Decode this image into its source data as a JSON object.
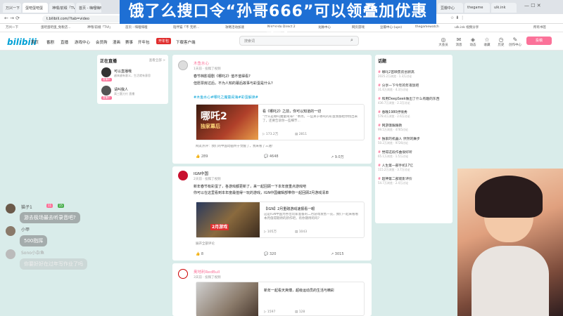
{
  "browser": {
    "tabs": [
      "万兴一下",
      "蛋吧蛋吧蛋",
      "神嘿/前缀「TVI」",
      "首页 - 嗨哩嗨哩",
      "陪伴猫「不 无所",
      "攻略活动",
      "加速",
      "Nintendo Direct",
      "龙脉中心",
      "网页游戏",
      "豆瓣中心",
      "thegame",
      "ulk.ink"
    ],
    "url": "t.bilibili.com/?tab=video",
    "bookmarks": [
      "万兴一下",
      "蛋吧蛋吧蛋_免税店...",
      "神嘿/前缀「TVI」",
      "首页 - 嗨哩嗨哩",
      "陪伴猫「不 无所...",
      "攻略活动加速",
      "Nintendo Direct 2",
      "龙脉中心",
      "网页游戏",
      "豆瓣中心-(ups)",
      "thegamewatch",
      "ulk.ink 视频分享",
      "所有书签"
    ]
  },
  "banner": "饿了么搜口令“孙哥666”可以领叠加优惠券!",
  "header": {
    "logo": "bilibili",
    "nav": [
      "首页",
      "番剧",
      "直播",
      "游戏中心",
      "会员购",
      "漫画",
      "赛事",
      "开年包",
      "下载客户端"
    ],
    "nav_tag": "开年包",
    "search_placeholder": "搜索词",
    "icons": [
      "大会员",
      "消息",
      "动态",
      "收藏",
      "历史",
      "创作中心"
    ],
    "upload": "投稿"
  },
  "live": {
    "title": "正在直播",
    "more": "查看全部 >",
    "items": [
      {
        "name": "可以直播哦",
        "desc": "越来越有意义，生活就有意思",
        "badge": "直播中"
      },
      {
        "name": "请叫我人",
        "desc": "高三题刀刃 直播",
        "badge": "直播中"
      }
    ]
  },
  "posts": [
    {
      "author": "木鱼水心",
      "meta": "1天前 · 投稿了视频",
      "text1": "春节档影视剧《哪吒2》值不值得看?",
      "text2": "但愿票房过后，不为人知的幕后故事与彩蛋是什么?",
      "tags": "#木鱼水心#哪吒之魔童闹海#彩蛋解读#",
      "thumb": "哪吒2",
      "thumb_sub": "独家幕后",
      "vtitle": "看《哪吒2》之前，你可以知道的一切",
      "vdesc": "“什么是哪吒魔童闹海？”本周，一些关于哪吒的彩蛋我都给你找出来了，还要告诉你一些细节...",
      "views": "173.2万",
      "danmu": "2811",
      "comment_preview": "网友热评：我们的中国动画终于觉醒了，我来看了三遍!",
      "likes": "289",
      "comments": "4648",
      "shares": "9.0万"
    },
    {
      "author": "IGN中国",
      "meta": "2天前 · 投稿了视频",
      "text1": "新年春节有彩蛋了，各游戏都更新了，来一起回顾一下本年度重点游戏吧",
      "text2": "你可以在这里看到本年度最值得一玩的游戏，IGN中国编辑部带你一起回顾2月游戏清单",
      "thumb": "2月游戏",
      "vtitle": "【IGN】2月重磅游戏速报看一眼",
      "vdesc": "这是IGN中国为各位玩家准备的二月游戏发售一览，我们一起来看看本月值得期待的新作吧，有你期待的吗?",
      "views": "105万",
      "danmu": "1043",
      "comment_preview": "展开全部评论",
      "likes": "8",
      "comments": "320",
      "shares": "3015"
    },
    {
      "author": "奥地利RedBull",
      "meta": "3天前 · 投稿了视频",
      "vtitle": "新年一起看天爽傅，超级运动员的生活与精彩",
      "views": "1597",
      "danmu": "128"
    }
  ],
  "hot": {
    "title": "话题",
    "items": [
      {
        "t": "哪吒2首映票房创新高",
        "s": "2025.2万浏览 · 1.3万讨论"
      },
      {
        "t": "分享一下今年的年夜饭吧",
        "s": "31.6万浏览 · 4.3万讨论"
      },
      {
        "t": "和用DeepSeek做出了什么有趣的东西",
        "s": "436.7万浏览 · 2.3万讨论"
      },
      {
        "t": "春晚1980抒情秀",
        "s": "578.4万浏览 · 2.6万讨论"
      },
      {
        "t": "网游饿跟跟教",
        "s": "99.5万浏览 · 4765讨论"
      },
      {
        "t": "独家的机器人 然然的舞步",
        "s": "50.2万浏览 · 9726讨论"
      },
      {
        "t": "觉得这段作曲很好听",
        "s": "65.1万浏览 · 1.5万讨论"
      },
      {
        "t": "人生第一部手机17亿",
        "s": "115.2万浏览 · 3.7万讨论"
      },
      {
        "t": "超神第二部观影评价",
        "s": "54.7万浏览 · 2.4万讨论"
      }
    ]
  },
  "chat": {
    "messages": [
      "游去极场最去听录音吧?",
      "500指挥"
    ],
    "users": [
      "猫子1",
      "小甲",
      "Sono小杂鱼",
      "好友"
    ],
    "levels": [
      "11",
      "25"
    ],
    "faded": "你要好好在过年写作业了吗"
  },
  "side": [
    "新的动态",
    "顶部"
  ]
}
